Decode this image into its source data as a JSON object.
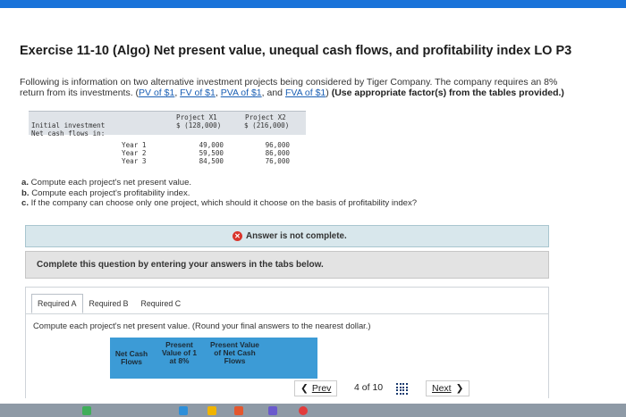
{
  "title": "Exercise 11-10 (Algo) Net present value, unequal cash flows, and profitability index LO P3",
  "intro": {
    "line1": "Following is information on two alternative investment projects being considered by Tiger Company. The company requires an 8%",
    "line2_prefix": "return from its investments. (",
    "links": [
      "PV of $1",
      "FV of $1",
      "PVA of $1",
      "FVA of $1"
    ],
    "sep": ", ",
    "and_text": ", and ",
    "close_paren": ")",
    "instruction": "(Use appropriate factor(s) from the tables provided.)"
  },
  "data_table": {
    "columns": [
      "Project X1",
      "Project X2"
    ],
    "rows": [
      {
        "label": "Initial investment",
        "values": [
          "$ (128,000)",
          "$ (216,000)"
        ]
      },
      {
        "label": "Net cash flows in:",
        "values": [
          "",
          ""
        ]
      },
      {
        "label": "Year 1",
        "values": [
          "49,000",
          "96,000"
        ]
      },
      {
        "label": "Year 2",
        "values": [
          "59,500",
          "86,000"
        ]
      },
      {
        "label": "Year 3",
        "values": [
          "84,500",
          "76,000"
        ]
      }
    ]
  },
  "questions": [
    {
      "letter": "a.",
      "text": " Compute each project's net present value."
    },
    {
      "letter": "b.",
      "text": " Compute each project's profitability index."
    },
    {
      "letter": "c.",
      "text": " If the company can choose only one project, which should it choose on the basis of profitability index?"
    }
  ],
  "status": {
    "text": "Answer is not complete.",
    "icon": "x-circle-icon",
    "color": "#d9352c"
  },
  "instruction_bar": "Complete this question by entering your answers in the tabs below.",
  "tabs": [
    {
      "label": "Required A",
      "active": true
    },
    {
      "label": "Required B",
      "active": false
    },
    {
      "label": "Required C",
      "active": false
    }
  ],
  "required_text": "Compute each project's net present value. (Round your final answers to the nearest dollar.)",
  "answer_table": {
    "headers": [
      "Net Cash\nFlows",
      "Present\nValue of 1\nat 8%",
      "Present Value\nof Net Cash\nFlows"
    ],
    "header_bg": "#3c9bd6"
  },
  "nav": {
    "prev_label": "Prev",
    "page_current": "4",
    "page_of": "of",
    "page_total": "10",
    "next_label": "Next"
  },
  "colors": {
    "accent": "#1a73d9",
    "link": "#1a5fb4"
  }
}
